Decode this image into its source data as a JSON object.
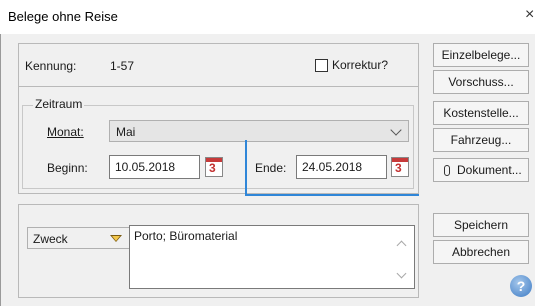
{
  "window": {
    "title": "Belege ohne Reise",
    "close": "×"
  },
  "header": {
    "kennung_label": "Kennung:",
    "kennung_value": "1-57",
    "korrektur_label": "Korrektur?",
    "korrektur_checked": false
  },
  "zeitraum": {
    "group_label": "Zeitraum",
    "monat_label": "Monat:",
    "monat_value": "Mai",
    "beginn_label": "Beginn:",
    "beginn_value": "10.05.2018",
    "ende_label": "Ende:",
    "ende_value": "24.05.2018",
    "calendar_digit": "3"
  },
  "zweck": {
    "dropdown_label": "Zweck",
    "text": "Porto; Büromaterial"
  },
  "buttons": {
    "einzelbelege": "Einzelbelege...",
    "vorschuss": "Vorschuss...",
    "kostenstelle": "Kostenstelle...",
    "fahrzeug": "Fahrzeug...",
    "dokument": "Dokument...",
    "speichern": "Speichern",
    "abbrechen": "Abbrechen",
    "help": "?"
  },
  "colors": {
    "accent_line": "#2f86d8",
    "calendar_red": "#c73a3a"
  }
}
